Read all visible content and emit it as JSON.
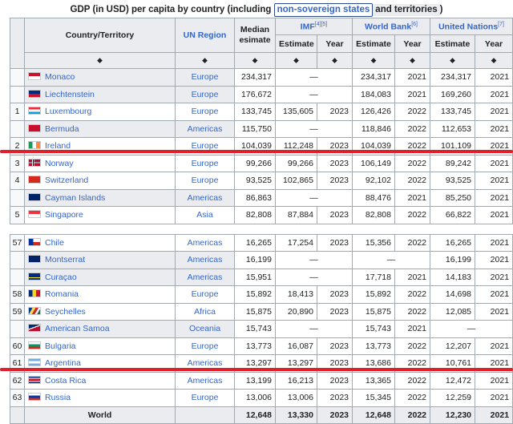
{
  "caption": {
    "lead": "GDP (in USD) per capita by country (including ",
    "highlight": "non-sovereign states",
    "tail": " and territories",
    "end": ")"
  },
  "headers": {
    "country": "Country/Territory",
    "region": "UN Region",
    "median": "Median esimate",
    "imf": "IMF",
    "imf_ref": "[4][5]",
    "wb": "World Bank",
    "wb_ref": "[6]",
    "un": "United Nations",
    "un_ref": "[7]",
    "estimate": "Estimate",
    "year": "Year",
    "sort_glyph": "⬥"
  },
  "dash": "—",
  "rows_top": [
    {
      "rank": "",
      "country": "Monaco",
      "region": "Europe",
      "median": "234,317",
      "imf_est": "—",
      "imf_year": "",
      "wb_est": "234,317",
      "wb_year": "2021",
      "un_est": "234,317",
      "un_year": "2021",
      "gray": true,
      "flag": "monaco"
    },
    {
      "rank": "",
      "country": "Liechtenstein",
      "region": "Europe",
      "median": "176,672",
      "imf_est": "—",
      "imf_year": "",
      "wb_est": "184,083",
      "wb_year": "2021",
      "un_est": "169,260",
      "un_year": "2021",
      "gray": true,
      "flag": "liechtenstein"
    },
    {
      "rank": "1",
      "country": "Luxembourg",
      "region": "Europe",
      "median": "133,745",
      "imf_est": "135,605",
      "imf_year": "2023",
      "wb_est": "126,426",
      "wb_year": "2022",
      "un_est": "133,745",
      "un_year": "2021",
      "gray": false,
      "flag": "luxembourg"
    },
    {
      "rank": "",
      "country": "Bermuda",
      "region": "Americas",
      "median": "115,750",
      "imf_est": "—",
      "imf_year": "",
      "wb_est": "118,846",
      "wb_year": "2022",
      "un_est": "112,653",
      "un_year": "2021",
      "gray": true,
      "flag": "bermuda"
    },
    {
      "rank": "2",
      "country": "Ireland",
      "region": "Europe",
      "median": "104,039",
      "imf_est": "112,248",
      "imf_year": "2023",
      "wb_est": "104,039",
      "wb_year": "2022",
      "un_est": "101,109",
      "un_year": "2021",
      "gray": false,
      "flag": "ireland"
    },
    {
      "rank": "3",
      "country": "Norway",
      "region": "Europe",
      "median": "99,266",
      "imf_est": "99,266",
      "imf_year": "2023",
      "wb_est": "106,149",
      "wb_year": "2022",
      "un_est": "89,242",
      "un_year": "2021",
      "gray": false,
      "flag": "norway"
    },
    {
      "rank": "4",
      "country": "Switzerland",
      "region": "Europe",
      "median": "93,525",
      "imf_est": "102,865",
      "imf_year": "2023",
      "wb_est": "92,102",
      "wb_year": "2022",
      "un_est": "93,525",
      "un_year": "2021",
      "gray": false,
      "flag": "switzerland"
    },
    {
      "rank": "",
      "country": "Cayman Islands",
      "region": "Americas",
      "median": "86,863",
      "imf_est": "—",
      "imf_year": "",
      "wb_est": "88,476",
      "wb_year": "2021",
      "un_est": "85,250",
      "un_year": "2021",
      "gray": true,
      "flag": "cayman"
    },
    {
      "rank": "5",
      "country": "Singapore",
      "region": "Asia",
      "median": "82,808",
      "imf_est": "87,884",
      "imf_year": "2023",
      "wb_est": "82,808",
      "wb_year": "2022",
      "un_est": "66,822",
      "un_year": "2021",
      "gray": false,
      "flag": "singapore"
    }
  ],
  "rows_bottom": [
    {
      "rank": "57",
      "country": "Chile",
      "region": "Americas",
      "median": "16,265",
      "imf_est": "17,254",
      "imf_year": "2023",
      "wb_est": "15,356",
      "wb_year": "2022",
      "un_est": "16,265",
      "un_year": "2021",
      "gray": false,
      "flag": "chile"
    },
    {
      "rank": "",
      "country": "Montserrat",
      "region": "Americas",
      "median": "16,199",
      "imf_est": "—",
      "imf_year": "",
      "wb_est": "—",
      "wb_year": "",
      "un_est": "16,199",
      "un_year": "2021",
      "gray": true,
      "flag": "montserrat"
    },
    {
      "rank": "",
      "country": "Curaçao",
      "region": "Americas",
      "median": "15,951",
      "imf_est": "—",
      "imf_year": "",
      "wb_est": "17,718",
      "wb_year": "2021",
      "un_est": "14,183",
      "un_year": "2021",
      "gray": true,
      "flag": "curacao"
    },
    {
      "rank": "58",
      "country": "Romania",
      "region": "Europe",
      "median": "15,892",
      "imf_est": "18,413",
      "imf_year": "2023",
      "wb_est": "15,892",
      "wb_year": "2022",
      "un_est": "14,698",
      "un_year": "2021",
      "gray": false,
      "flag": "romania"
    },
    {
      "rank": "59",
      "country": "Seychelles",
      "region": "Africa",
      "median": "15,875",
      "imf_est": "20,890",
      "imf_year": "2023",
      "wb_est": "15,875",
      "wb_year": "2022",
      "un_est": "12,085",
      "un_year": "2021",
      "gray": false,
      "flag": "seychelles"
    },
    {
      "rank": "",
      "country": "American Samoa",
      "region": "Oceania",
      "median": "15,743",
      "imf_est": "—",
      "imf_year": "",
      "wb_est": "15,743",
      "wb_year": "2021",
      "un_est": "—",
      "un_year": "",
      "gray": true,
      "flag": "amsamoa"
    },
    {
      "rank": "60",
      "country": "Bulgaria",
      "region": "Europe",
      "median": "13,773",
      "imf_est": "16,087",
      "imf_year": "2023",
      "wb_est": "13,773",
      "wb_year": "2022",
      "un_est": "12,207",
      "un_year": "2021",
      "gray": false,
      "flag": "bulgaria"
    },
    {
      "rank": "61",
      "country": "Argentina",
      "region": "Americas",
      "median": "13,297",
      "imf_est": "13,297",
      "imf_year": "2023",
      "wb_est": "13,686",
      "wb_year": "2022",
      "un_est": "10,761",
      "un_year": "2021",
      "gray": false,
      "flag": "argentina"
    },
    {
      "rank": "62",
      "country": "Costa Rica",
      "region": "Americas",
      "median": "13,199",
      "imf_est": "16,213",
      "imf_year": "2023",
      "wb_est": "13,365",
      "wb_year": "2022",
      "un_est": "12,472",
      "un_year": "2021",
      "gray": false,
      "flag": "costarica"
    },
    {
      "rank": "63",
      "country": "Russia",
      "region": "Europe",
      "median": "13,006",
      "imf_est": "13,006",
      "imf_year": "2023",
      "wb_est": "15,345",
      "wb_year": "2022",
      "un_est": "12,259",
      "un_year": "2021",
      "gray": false,
      "flag": "russia"
    }
  ],
  "world": {
    "country": "World",
    "median": "12,648",
    "imf_est": "13,330",
    "imf_year": "2023",
    "wb_est": "12,648",
    "wb_year": "2022",
    "un_est": "12,230",
    "un_year": "2021"
  },
  "highlight_color": "#e0202a",
  "link_color": "#3366cc"
}
